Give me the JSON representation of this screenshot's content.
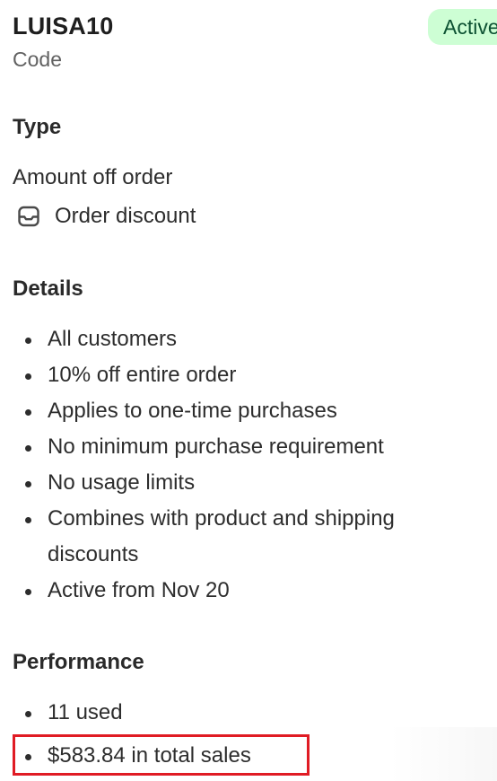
{
  "discount": {
    "code": "LUISA10",
    "code_label": "Code",
    "status": "Active"
  },
  "type_section": {
    "heading": "Type",
    "amount_type": "Amount off order",
    "discount_kind": "Order discount",
    "discount_kind_icon": "order-discount-icon"
  },
  "details": {
    "heading": "Details",
    "items": [
      "All customers",
      "10% off entire order",
      "Applies to one-time purchases",
      "No minimum purchase requirement",
      "No usage limits",
      "Combines with product and shipping discounts",
      "Active from Nov 20"
    ]
  },
  "performance": {
    "heading": "Performance",
    "items": [
      "11 used",
      "$583.84 in total sales"
    ]
  },
  "colors": {
    "badge_bg": "#cdfed4",
    "badge_text": "#0c5132",
    "highlight": "#e01b24"
  }
}
